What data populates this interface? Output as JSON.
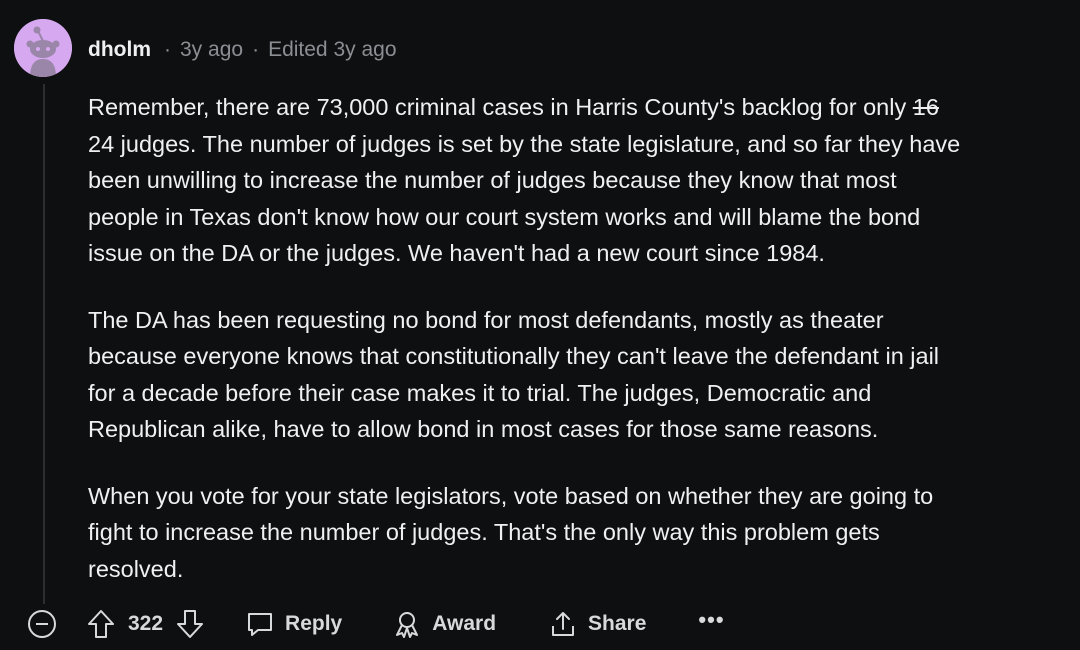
{
  "comment": {
    "username": "dholm",
    "age": "3y ago",
    "edited": "Edited 3y ago",
    "paragraphs": {
      "p1_line1_pre": "Remember, there are 73,000 criminal cases in Harris County's backlog for only ",
      "p1_struck": "16",
      "p1_line2": "24 judges. The number of judges is set by the state legislature, and so far they have",
      "p1_line3": "been unwilling to increase the number of judges because they know that most",
      "p1_line4": "people in Texas don't know how our court system works and will blame the bond",
      "p1_line5": "issue on the DA or the judges. We haven't had a new court since 1984.",
      "p2_line1": "The DA has been requesting no bond for most defendants, mostly as theater",
      "p2_line2": "because everyone knows that constitutionally they can't leave the defendant in jail",
      "p2_line3": "for a decade before their case makes it to trial. The judges, Democratic and",
      "p2_line4": "Republican alike, have to allow bond in most cases for those same reasons.",
      "p3_line1": "When you vote for your state legislators, vote based on whether they are going to",
      "p3_line2": "fight to increase the number of judges. That's the only way this problem gets",
      "p3_line3": "resolved."
    }
  },
  "actions": {
    "score": "322",
    "reply_label": "Reply",
    "award_label": "Award",
    "share_label": "Share",
    "more_label": "•••"
  },
  "colors": {
    "background": "#0e0f10",
    "text": "#eef0f1",
    "muted": "#8b8f93",
    "avatar": "#d6a8f0"
  }
}
